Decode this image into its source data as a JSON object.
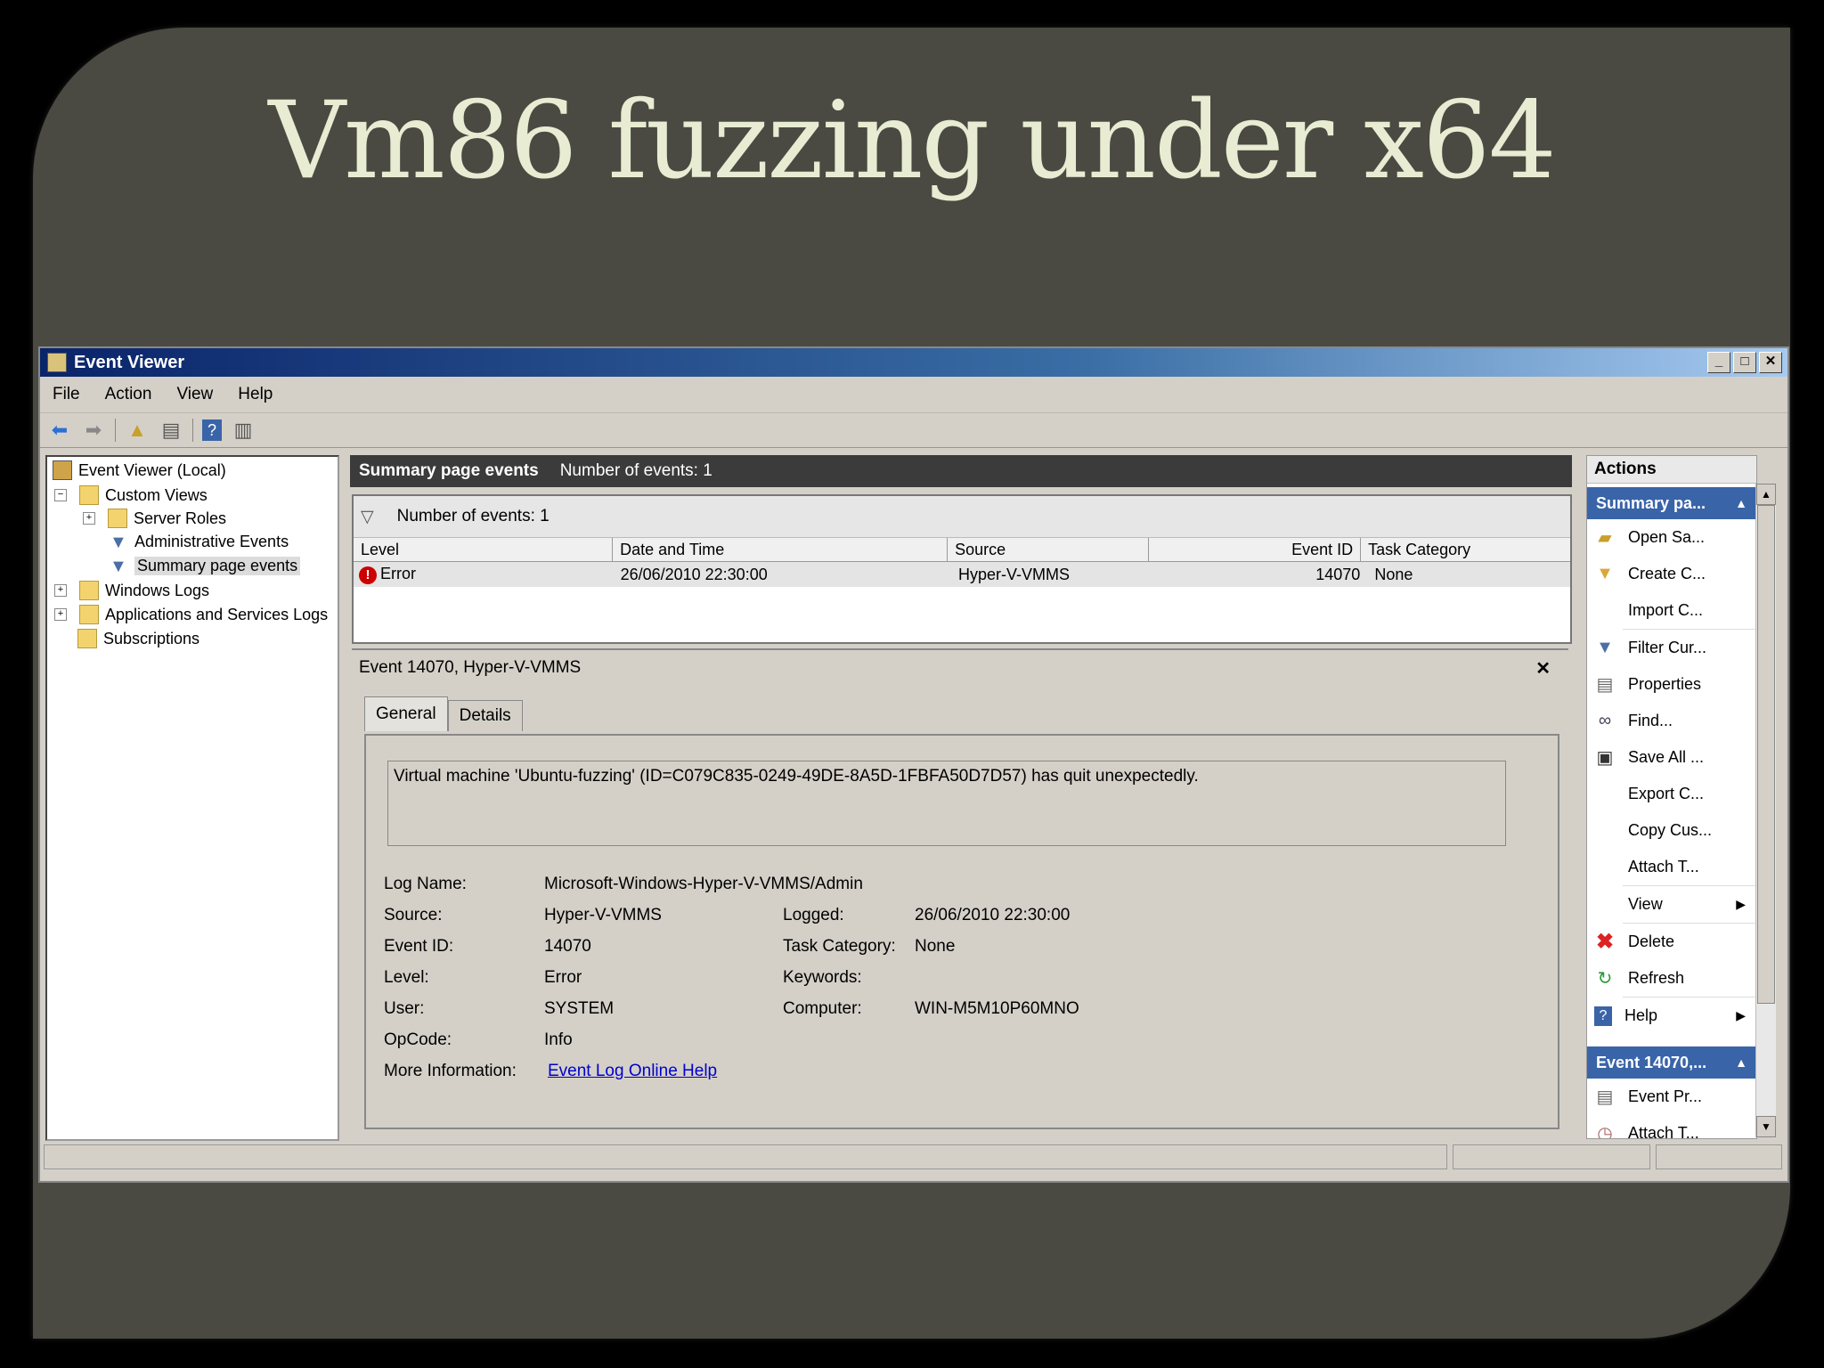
{
  "slide": {
    "title": "Vm86 fuzzing under x64"
  },
  "window": {
    "title": "Event Viewer",
    "buttons": {
      "minimize": "_",
      "maximize": "□",
      "close": "✕"
    }
  },
  "menu": [
    "File",
    "Action",
    "View",
    "Help"
  ],
  "tree": {
    "root": "Event Viewer (Local)",
    "custom_views": "Custom Views",
    "server_roles": "Server Roles",
    "admin_events": "Administrative Events",
    "summary_events": "Summary page events",
    "windows_logs": "Windows Logs",
    "app_services_logs": "Applications and Services Logs",
    "subscriptions": "Subscriptions"
  },
  "center": {
    "title": "Summary page events",
    "count": "Number of events: 1",
    "filter_count": "Number of events: 1",
    "columns": [
      "Level",
      "Date and Time",
      "Source",
      "Event ID",
      "Task Category"
    ],
    "row": {
      "level": "Error",
      "date": "26/06/2010 22:30:00",
      "source": "Hyper-V-VMMS",
      "event_id": "14070",
      "category": "None"
    }
  },
  "detail": {
    "title": "Event 14070, Hyper-V-VMMS",
    "close": "✕",
    "tabs": [
      "General",
      "Details"
    ],
    "message": "Virtual machine 'Ubuntu-fuzzing' (ID=C079C835-0249-49DE-8A5D-1FBFA50D7D57) has quit unexpectedly.",
    "labels": {
      "log_name": "Log Name:",
      "source": "Source:",
      "event_id": "Event ID:",
      "level": "Level:",
      "user": "User:",
      "opcode": "OpCode:",
      "more_info": "More Information:",
      "logged": "Logged:",
      "task_category": "Task Category:",
      "keywords": "Keywords:",
      "computer": "Computer:"
    },
    "values": {
      "log_name": "Microsoft-Windows-Hyper-V-VMMS/Admin",
      "source": "Hyper-V-VMMS",
      "event_id": "14070",
      "level": "Error",
      "user": "SYSTEM",
      "opcode": "Info",
      "more_info": "Event Log Online Help",
      "logged": "26/06/2010 22:30:00",
      "task_category": "None",
      "computer": "WIN-M5M10P60MNO"
    }
  },
  "actions": {
    "title": "Actions",
    "section1": "Summary pa...",
    "items1": [
      "Open Sa...",
      "Create C...",
      "Import C...",
      "Filter Cur...",
      "Properties",
      "Find...",
      "Save All ...",
      "Export C...",
      "Copy Cus...",
      "Attach T...",
      "View",
      "Delete",
      "Refresh",
      "Help"
    ],
    "section2": "Event 14070,...",
    "items2": [
      "Event Pr...",
      "Attach T..."
    ]
  }
}
